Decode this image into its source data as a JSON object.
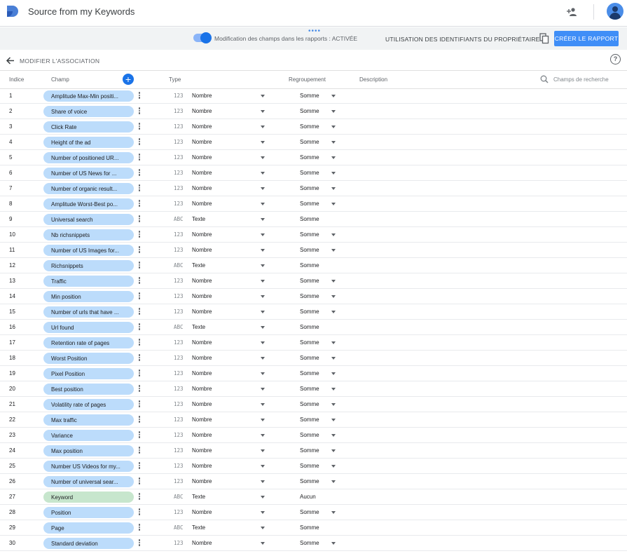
{
  "app": {
    "title": "Source from my Keywords",
    "logo_icon": "data-studio-logo-icon",
    "accent_color": "#1a73e8"
  },
  "toolbar": {
    "field_edit_label": "Modification des champs dans les rapports : ACTIVÉE",
    "field_edit_enabled": true,
    "credentials_label": "UTILISATION DES IDENTIFIANTS DU PROPRIÉTAIRE",
    "create_report_label": "CRÉER LE RAPPORT"
  },
  "section": {
    "title": "MODIFIER L'ASSOCIATION"
  },
  "columns": {
    "index": "Indice",
    "field": "Champ",
    "type": "Type",
    "aggregation": "Regroupement",
    "description": "Description"
  },
  "search": {
    "placeholder": "Champs de recherche"
  },
  "rows": [
    {
      "index": "1",
      "field": "Amplitude Max-Min positi...",
      "type_icon": "123",
      "type": "Nombre",
      "aggregation": "Somme",
      "agg_dropdown": true,
      "dimension": false
    },
    {
      "index": "2",
      "field": "Share of voice",
      "type_icon": "123",
      "type": "Nombre",
      "aggregation": "Somme",
      "agg_dropdown": true,
      "dimension": false
    },
    {
      "index": "3",
      "field": "Click Rate",
      "type_icon": "123",
      "type": "Nombre",
      "aggregation": "Somme",
      "agg_dropdown": true,
      "dimension": false
    },
    {
      "index": "4",
      "field": "Height of the ad",
      "type_icon": "123",
      "type": "Nombre",
      "aggregation": "Somme",
      "agg_dropdown": true,
      "dimension": false
    },
    {
      "index": "5",
      "field": "Number of positioned UR...",
      "type_icon": "123",
      "type": "Nombre",
      "aggregation": "Somme",
      "agg_dropdown": true,
      "dimension": false
    },
    {
      "index": "6",
      "field": "Number of US News for ...",
      "type_icon": "123",
      "type": "Nombre",
      "aggregation": "Somme",
      "agg_dropdown": true,
      "dimension": false
    },
    {
      "index": "7",
      "field": "Number of organic result...",
      "type_icon": "123",
      "type": "Nombre",
      "aggregation": "Somme",
      "agg_dropdown": true,
      "dimension": false
    },
    {
      "index": "8",
      "field": "Amplitude Worst-Best po...",
      "type_icon": "123",
      "type": "Nombre",
      "aggregation": "Somme",
      "agg_dropdown": true,
      "dimension": false
    },
    {
      "index": "9",
      "field": "Universal search",
      "type_icon": "ABC",
      "type": "Texte",
      "aggregation": "Somme",
      "agg_dropdown": false,
      "dimension": false
    },
    {
      "index": "10",
      "field": "Nb richsnippets",
      "type_icon": "123",
      "type": "Nombre",
      "aggregation": "Somme",
      "agg_dropdown": true,
      "dimension": false
    },
    {
      "index": "11",
      "field": "Number of US Images for...",
      "type_icon": "123",
      "type": "Nombre",
      "aggregation": "Somme",
      "agg_dropdown": true,
      "dimension": false
    },
    {
      "index": "12",
      "field": "Richsnippets",
      "type_icon": "ABC",
      "type": "Texte",
      "aggregation": "Somme",
      "agg_dropdown": false,
      "dimension": false
    },
    {
      "index": "13",
      "field": "Traffic",
      "type_icon": "123",
      "type": "Nombre",
      "aggregation": "Somme",
      "agg_dropdown": true,
      "dimension": false
    },
    {
      "index": "14",
      "field": "Min position",
      "type_icon": "123",
      "type": "Nombre",
      "aggregation": "Somme",
      "agg_dropdown": true,
      "dimension": false
    },
    {
      "index": "15",
      "field": "Number of urls that have ...",
      "type_icon": "123",
      "type": "Nombre",
      "aggregation": "Somme",
      "agg_dropdown": true,
      "dimension": false
    },
    {
      "index": "16",
      "field": "Url found",
      "type_icon": "ABC",
      "type": "Texte",
      "aggregation": "Somme",
      "agg_dropdown": false,
      "dimension": false
    },
    {
      "index": "17",
      "field": "Retention rate of pages",
      "type_icon": "123",
      "type": "Nombre",
      "aggregation": "Somme",
      "agg_dropdown": true,
      "dimension": false
    },
    {
      "index": "18",
      "field": "Worst Position",
      "type_icon": "123",
      "type": "Nombre",
      "aggregation": "Somme",
      "agg_dropdown": true,
      "dimension": false
    },
    {
      "index": "19",
      "field": "Pixel Position",
      "type_icon": "123",
      "type": "Nombre",
      "aggregation": "Somme",
      "agg_dropdown": true,
      "dimension": false
    },
    {
      "index": "20",
      "field": "Best position",
      "type_icon": "123",
      "type": "Nombre",
      "aggregation": "Somme",
      "agg_dropdown": true,
      "dimension": false
    },
    {
      "index": "21",
      "field": "Volatility rate of pages",
      "type_icon": "123",
      "type": "Nombre",
      "aggregation": "Somme",
      "agg_dropdown": true,
      "dimension": false
    },
    {
      "index": "22",
      "field": "Max traffic",
      "type_icon": "123",
      "type": "Nombre",
      "aggregation": "Somme",
      "agg_dropdown": true,
      "dimension": false
    },
    {
      "index": "23",
      "field": "Variance",
      "type_icon": "123",
      "type": "Nombre",
      "aggregation": "Somme",
      "agg_dropdown": true,
      "dimension": false
    },
    {
      "index": "24",
      "field": "Max position",
      "type_icon": "123",
      "type": "Nombre",
      "aggregation": "Somme",
      "agg_dropdown": true,
      "dimension": false
    },
    {
      "index": "25",
      "field": "Number US Videos for my...",
      "type_icon": "123",
      "type": "Nombre",
      "aggregation": "Somme",
      "agg_dropdown": true,
      "dimension": false
    },
    {
      "index": "26",
      "field": "Number of universal sear...",
      "type_icon": "123",
      "type": "Nombre",
      "aggregation": "Somme",
      "agg_dropdown": true,
      "dimension": false
    },
    {
      "index": "27",
      "field": "Keyword",
      "type_icon": "ABC",
      "type": "Texte",
      "aggregation": "Aucun",
      "agg_dropdown": false,
      "dimension": true
    },
    {
      "index": "28",
      "field": "Position",
      "type_icon": "123",
      "type": "Nombre",
      "aggregation": "Somme",
      "agg_dropdown": true,
      "dimension": false
    },
    {
      "index": "29",
      "field": "Page",
      "type_icon": "ABC",
      "type": "Texte",
      "aggregation": "Somme",
      "agg_dropdown": false,
      "dimension": false
    },
    {
      "index": "30",
      "field": "Standard deviation",
      "type_icon": "123",
      "type": "Nombre",
      "aggregation": "Somme",
      "agg_dropdown": true,
      "dimension": false
    }
  ]
}
